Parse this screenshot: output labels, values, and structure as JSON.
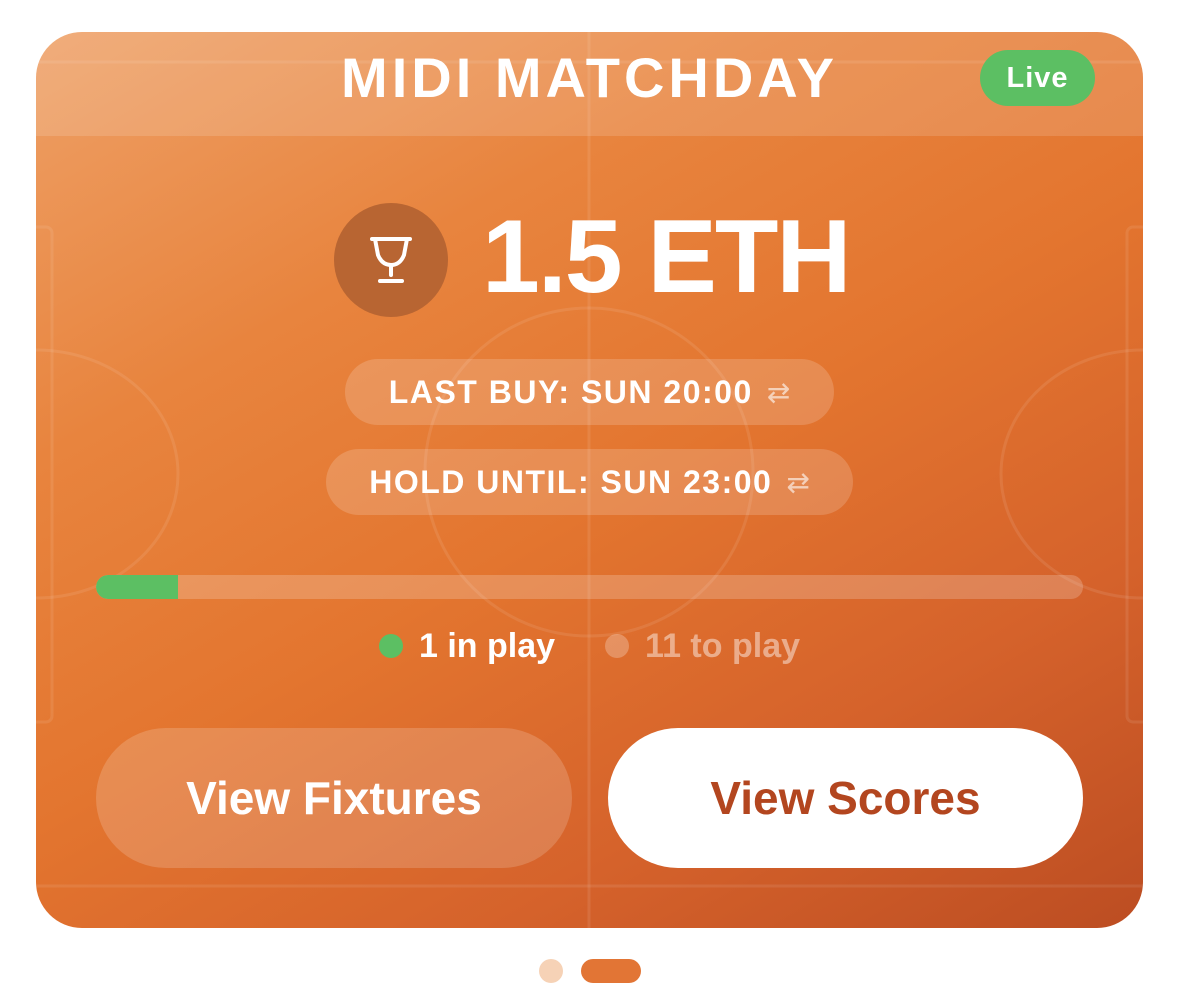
{
  "card": {
    "title": "MIDI MATCHDAY",
    "status_badge": "Live",
    "prize": "1.5 ETH",
    "prize_icon": "trophy-icon",
    "last_buy": "LAST BUY: SUN 20:00",
    "hold_until": "HOLD UNTIL: SUN 23:00",
    "swap_icon_glyph": "⇄",
    "progress_fraction": 0.083,
    "legend": {
      "in_play": "1 in play",
      "to_play": "11 to play"
    },
    "buttons": {
      "fixtures": "View Fixtures",
      "scores": "View Scores"
    }
  },
  "pager": {
    "pages": 2,
    "active_index": 1
  },
  "colors": {
    "accent_green": "#5cbf63",
    "card_orange": "#e3752f",
    "scores_text": "#b3461f",
    "pager_active": "#e27535",
    "pager_inactive": "#f6d2b6"
  }
}
